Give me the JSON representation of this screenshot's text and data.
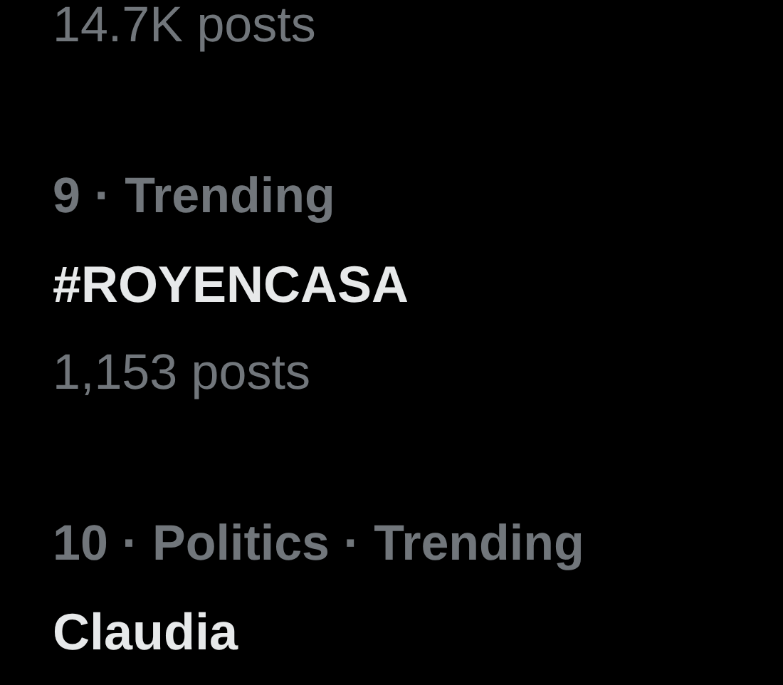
{
  "trends": [
    {
      "posts": "14.7K posts"
    },
    {
      "meta": "9 · Trending",
      "title": "#ROYENCASA",
      "posts": "1,153 posts"
    },
    {
      "meta": "10 · Politics · Trending",
      "title": "Claudia"
    }
  ]
}
